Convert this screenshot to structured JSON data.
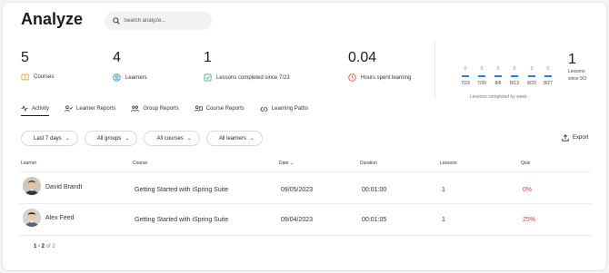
{
  "header": {
    "title": "Analyze"
  },
  "search": {
    "placeholder": "Search analyze..."
  },
  "stats": [
    {
      "value": "5",
      "label": "Courses",
      "icon": "book-icon",
      "color": "#e8a23a"
    },
    {
      "value": "4",
      "label": "Learners",
      "icon": "user-circle-icon",
      "color": "#3b8de8"
    },
    {
      "value": "1",
      "label": "Lessons completed since 7/23",
      "icon": "check-square-icon",
      "color": "#3bb56e"
    },
    {
      "value": "0.04",
      "label": "Hours spent learning",
      "icon": "clock-icon",
      "color": "#e85a3b"
    }
  ],
  "weekly": {
    "weeks": [
      {
        "count": "0",
        "date": "7/23"
      },
      {
        "count": "0",
        "date": "7/30"
      },
      {
        "count": "0",
        "date": "8/6"
      },
      {
        "count": "0",
        "date": "8/13"
      },
      {
        "count": "0",
        "date": "8/20"
      },
      {
        "count": "0",
        "date": "8/27"
      }
    ],
    "caption": "Lessons completed by week",
    "bar_color": "#2f7de1"
  },
  "since": {
    "value": "1",
    "label_line1": "Lessons",
    "label_line2": "since 9/3"
  },
  "tabs": [
    {
      "label": "Activity",
      "icon": "activity-icon"
    },
    {
      "label": "Learner Reports",
      "icon": "learner-reports-icon"
    },
    {
      "label": "Group Reports",
      "icon": "group-icon"
    },
    {
      "label": "Course Reports",
      "icon": "course-reports-icon"
    },
    {
      "label": "Learning Paths",
      "icon": "path-icon"
    }
  ],
  "filters": [
    {
      "label": "Last 7 days"
    },
    {
      "label": "All groups"
    },
    {
      "label": "All courses"
    },
    {
      "label": "All learners"
    }
  ],
  "export": {
    "label": "Export"
  },
  "table": {
    "columns": {
      "learner": "Learner",
      "course": "Course",
      "date": "Date",
      "duration": "Duration",
      "lessons": "Lessons",
      "quiz": "Quiz"
    },
    "rows": [
      {
        "learner": "David Brandt",
        "course": "Getting Started with iSpring Suite",
        "date": "09/05/2023",
        "duration": "00:01:00",
        "lessons": "1",
        "quiz": "0%"
      },
      {
        "learner": "Alex Feed",
        "course": "Getting Started with iSpring Suite",
        "date": "09/04/2023",
        "duration": "00:01:05",
        "lessons": "1",
        "quiz": "25%"
      }
    ]
  },
  "pager": {
    "range": "1 - 2",
    "of": "of 2"
  }
}
